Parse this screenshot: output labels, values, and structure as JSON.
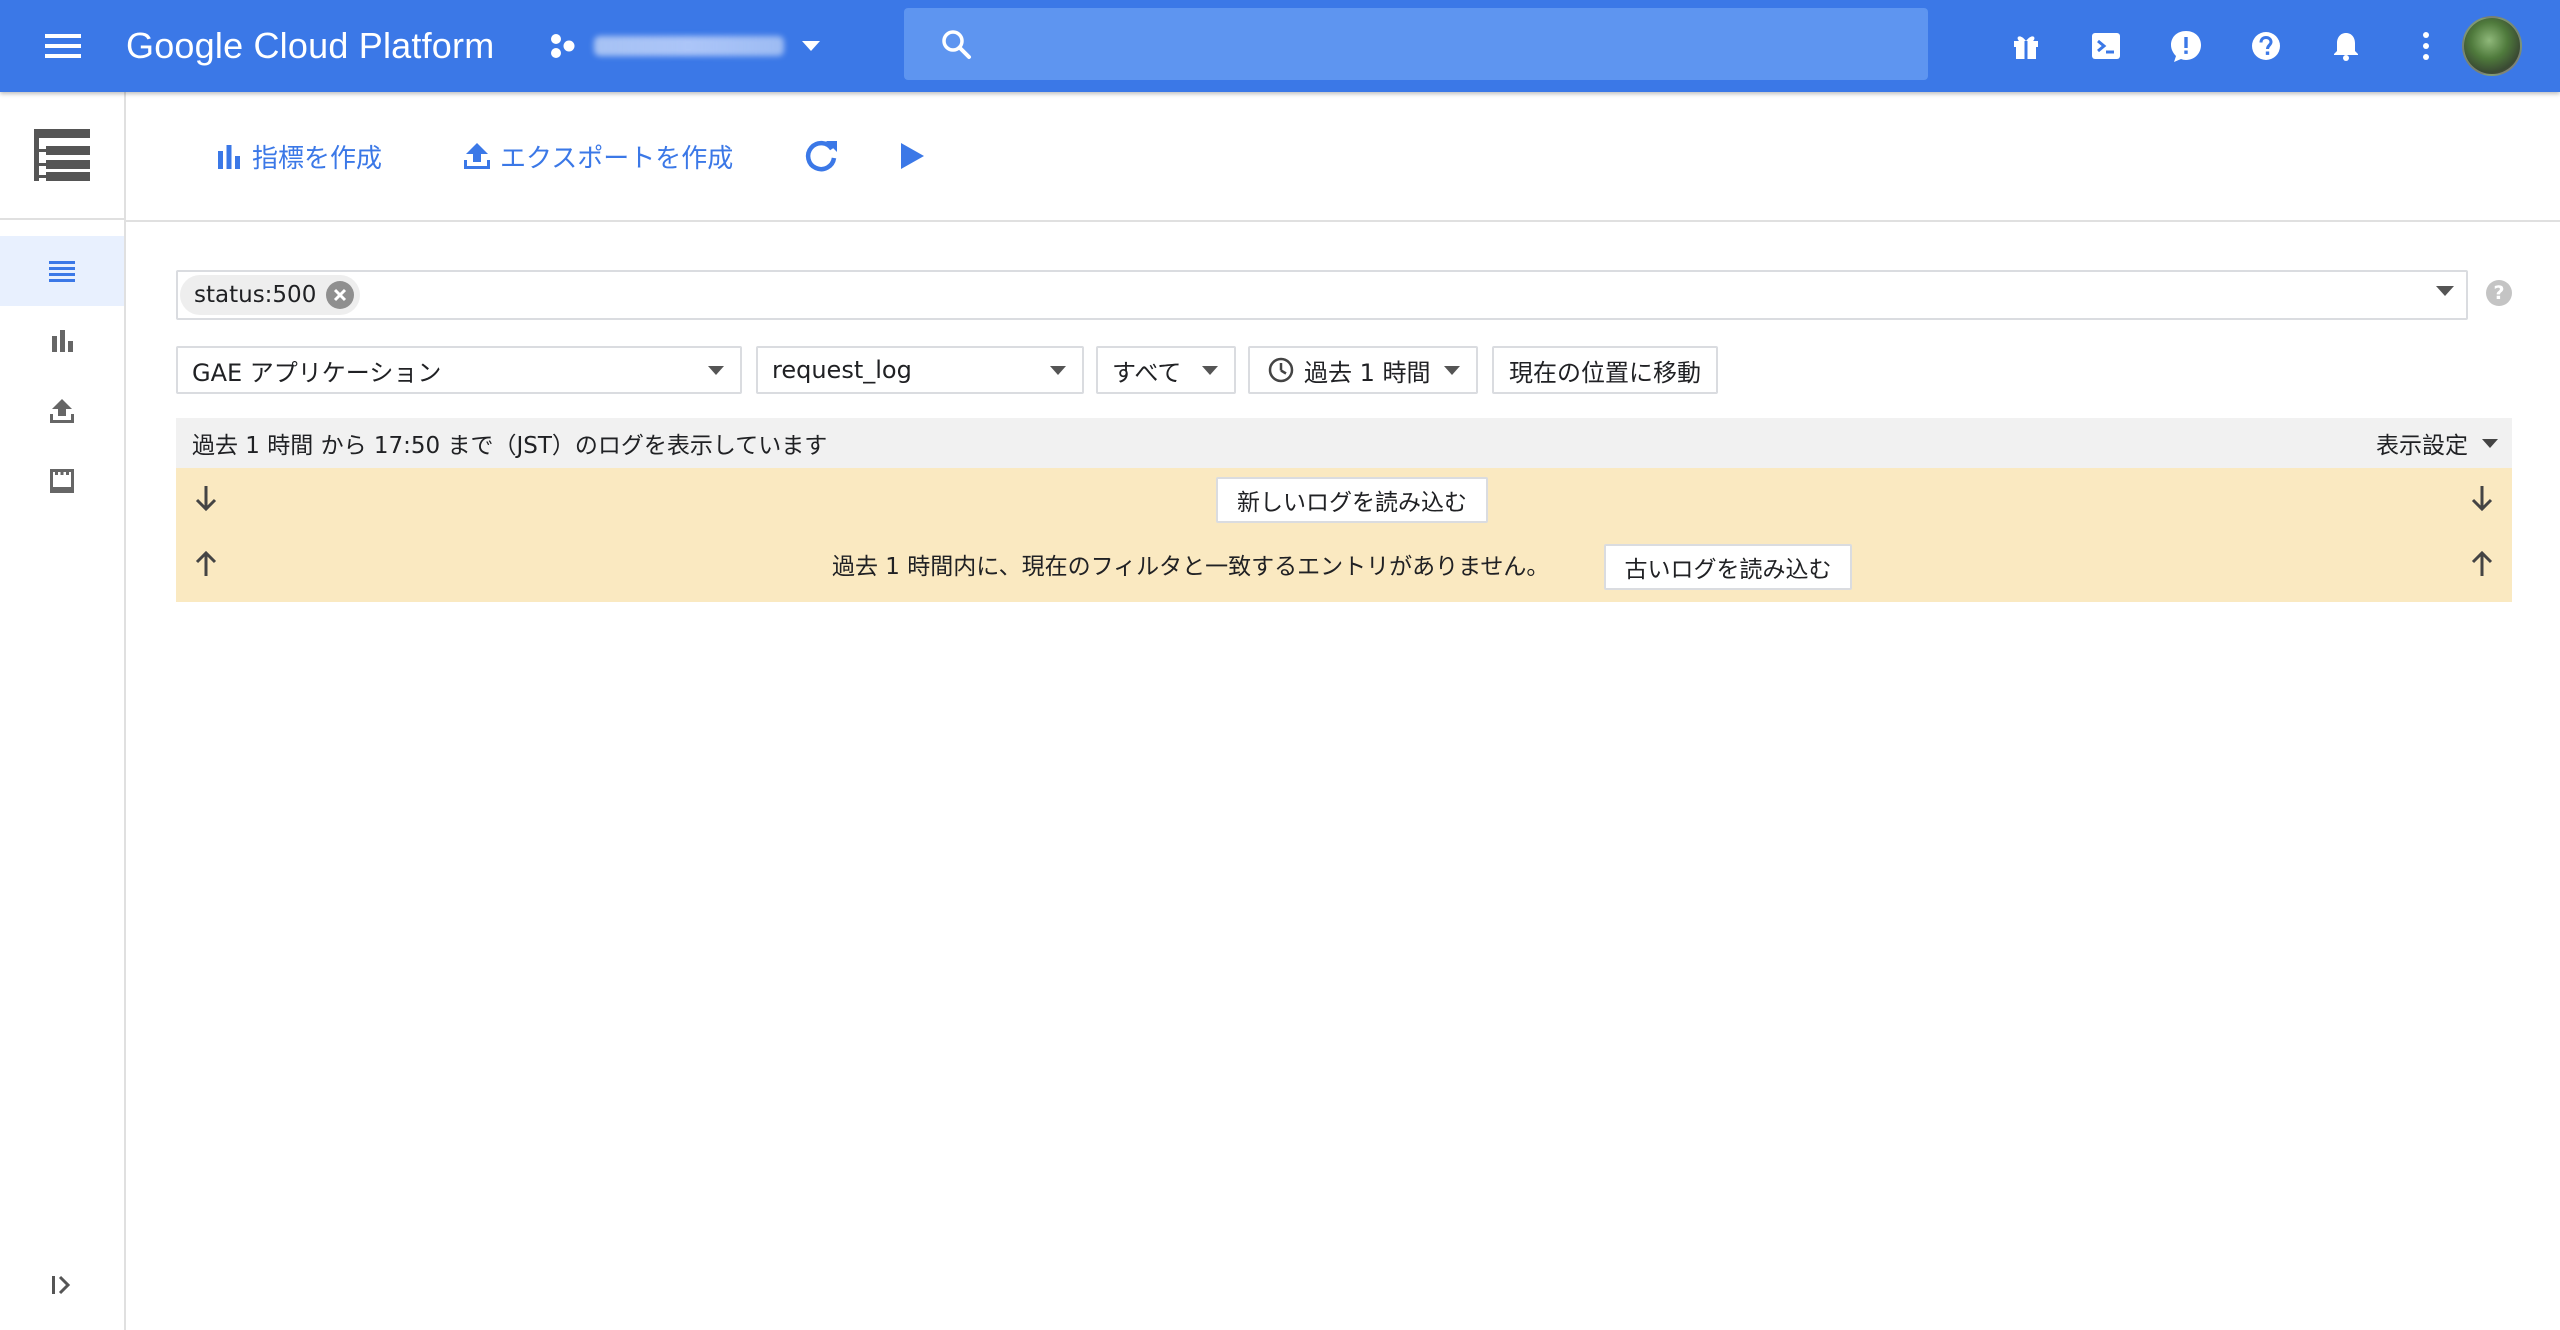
{
  "colors": {
    "appbar": "#3b78e7",
    "search_bg": "#5e95f0",
    "accent": "#3b78e7",
    "notice_bg": "#fae9c1",
    "status_bg": "#f1f1f1"
  },
  "header": {
    "brand": "Google Cloud Platform",
    "menu_icon": "hamburger-menu-icon",
    "project_icon": "project-nodes-icon",
    "search": {
      "value": "",
      "placeholder": ""
    },
    "actions": [
      "gift-icon",
      "cloud-shell-icon",
      "feedback-icon",
      "help-icon",
      "notifications-icon",
      "more-vert-icon"
    ]
  },
  "sidebar": {
    "header_icon": "logs-tree-icon",
    "items": [
      {
        "icon": "logs-list-icon",
        "active": true
      },
      {
        "icon": "bar-chart-icon",
        "active": false
      },
      {
        "icon": "export-upload-icon",
        "active": false
      },
      {
        "icon": "storage-icon",
        "active": false
      }
    ],
    "expand_icon": "expand-sidebar-icon"
  },
  "toolbar": {
    "create_metric": "指標を作成",
    "create_export": "エクスポートを作成",
    "refresh_icon": "refresh-icon",
    "play_icon": "play-icon"
  },
  "filter": {
    "chip": "status:500"
  },
  "selectors": {
    "resource": "GAE アプリケーション",
    "log": "request_log",
    "level": "すべて",
    "time": "過去 1 時間",
    "jump": "現在の位置に移動"
  },
  "status": {
    "text": "過去 1 時間 から 17:50 まで（JST）のログを表示しています",
    "display_settings": "表示設定"
  },
  "logs": {
    "load_newer": "新しいログを読み込む",
    "no_entries": "過去 1 時間内に、現在のフィルタと一致するエントリがありません。",
    "load_older": "古いログを読み込む"
  }
}
